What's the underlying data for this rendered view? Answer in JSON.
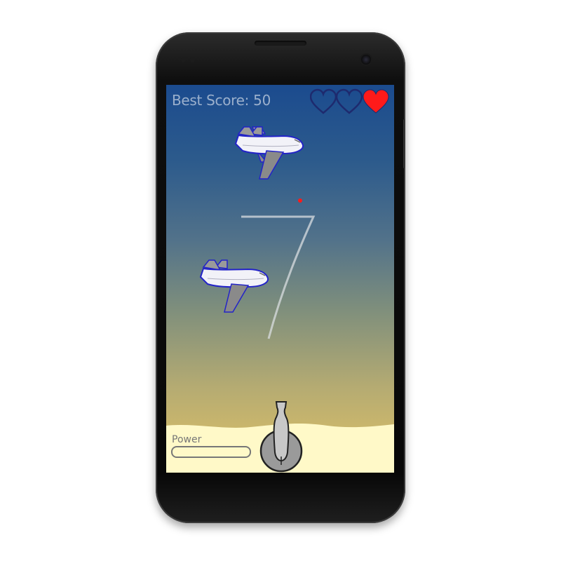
{
  "hud": {
    "best_score_text": "Best Score: 50",
    "lives_total": 3,
    "lives_remaining": 1,
    "heart_color": "#ff1a1a",
    "heart_outline_color": "#1e2a6e"
  },
  "game": {
    "current_score": "7",
    "power_label": "Power",
    "power_level": 0,
    "bullet_color": "#ff1a1a"
  },
  "colors": {
    "sky_top": "#1b4b8e",
    "sky_bottom": "#e0c266",
    "sand": "#fff9c8",
    "plane_outline": "#2323c8"
  },
  "icons": {
    "planes": "airplane-icon",
    "cannon": "cannon-icon",
    "lives": "heart-icon"
  }
}
